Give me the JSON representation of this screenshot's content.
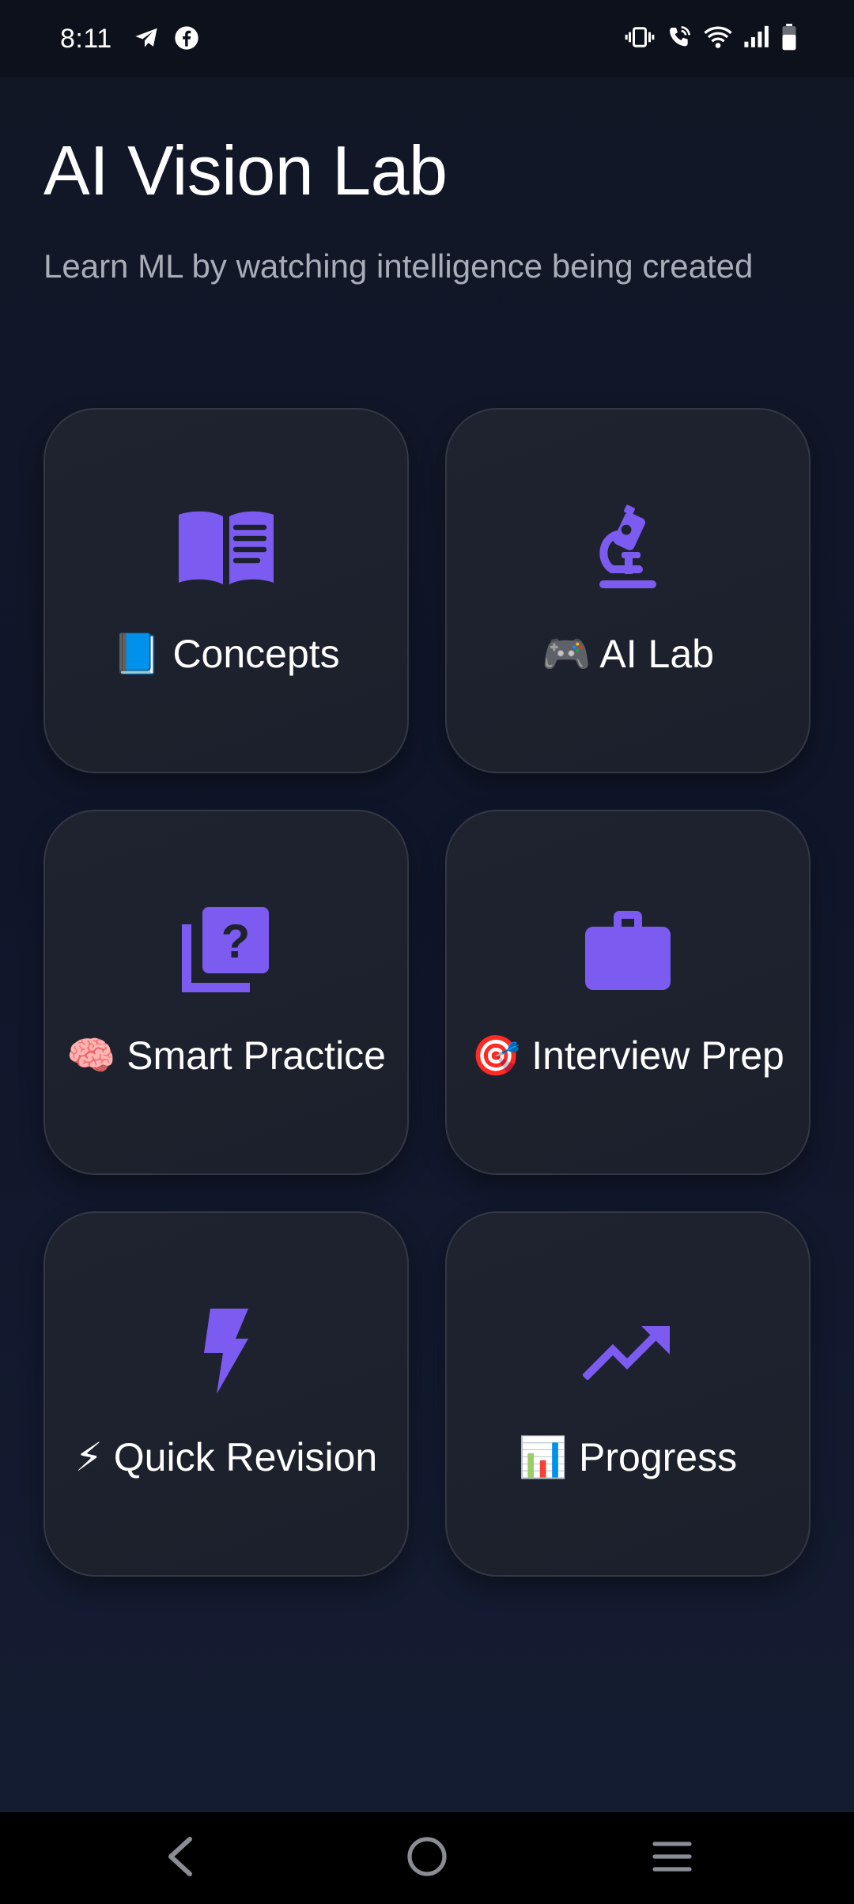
{
  "status_bar": {
    "time": "8:11"
  },
  "header": {
    "title": "AI Vision Lab",
    "subtitle": "Learn ML by watching intelligence being created"
  },
  "tiles": [
    {
      "label": "📘 Concepts",
      "icon": "open-book-icon"
    },
    {
      "label": "🎮 AI Lab",
      "icon": "microscope-icon"
    },
    {
      "label": "🧠 Smart Practice",
      "icon": "quiz-question-icon"
    },
    {
      "label": "🎯 Interview Prep",
      "icon": "briefcase-icon"
    },
    {
      "label": "⚡ Quick Revision",
      "icon": "lightning-bolt-icon"
    },
    {
      "label": "📊 Progress",
      "icon": "trending-up-icon"
    }
  ],
  "colors": {
    "accent": "#7c5cf0",
    "background": "#10162a",
    "tile": "#1e222d",
    "text_primary": "#ffffff",
    "text_secondary": "#a9adb8"
  }
}
